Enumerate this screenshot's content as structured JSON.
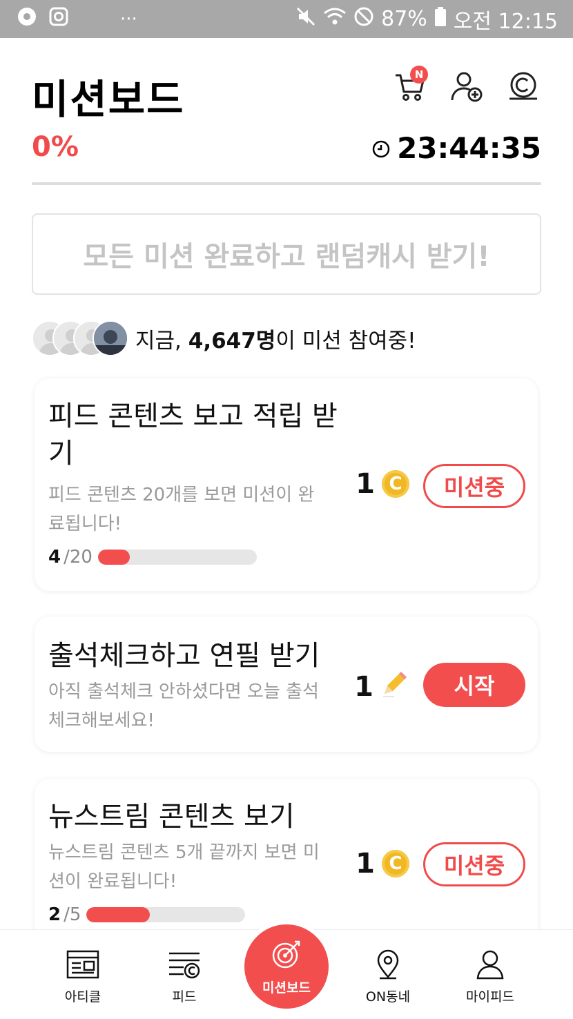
{
  "status_bar": {
    "battery": "87%",
    "time": "오전 12:15",
    "dots": "···"
  },
  "header": {
    "title": "미션보드",
    "cart_badge": "N",
    "icons": [
      "cart-icon",
      "add-friend-icon",
      "cash-icon"
    ]
  },
  "progress": {
    "percent": "0%",
    "timer": "23:44:35"
  },
  "banner": {
    "text": "모든 미션 완료하고 랜덤캐시 받기!"
  },
  "participants": {
    "prefix": "지금, ",
    "count": "4,647명",
    "suffix": "이 미션 참여중!"
  },
  "missions": [
    {
      "title": "피드 콘텐츠 보고 적립 받기",
      "desc": "피드 콘텐츠 20개를 보면 미션이 완료됩니다!",
      "progress_current": "4",
      "progress_total": "/20",
      "progress_fraction": 0.2,
      "reward": "1",
      "reward_icon": "coin-icon",
      "button": "미션중"
    },
    {
      "title": "출석체크하고 연필 받기",
      "desc": "아직 출석체크 안하셨다면 오늘 출석체크해보세요!",
      "reward": "1",
      "reward_icon": "pencil-icon",
      "button": "시작"
    },
    {
      "title": "뉴스트림 콘텐츠 보기",
      "desc": "뉴스트림 콘텐츠 5개 끝까지 보면 미션이 완료됩니다!",
      "progress_current": "2",
      "progress_total": "/5",
      "progress_fraction": 0.4,
      "reward": "1",
      "reward_icon": "coin-icon",
      "button": "미션중"
    }
  ],
  "nav": {
    "article": "아티클",
    "feed": "피드",
    "missionboard": "미션보드",
    "local": "ON동네",
    "myfeed": "마이피드"
  },
  "colors": {
    "accent": "#f34e4e",
    "coin": "#f1b824",
    "muted": "#9a9a9a"
  }
}
